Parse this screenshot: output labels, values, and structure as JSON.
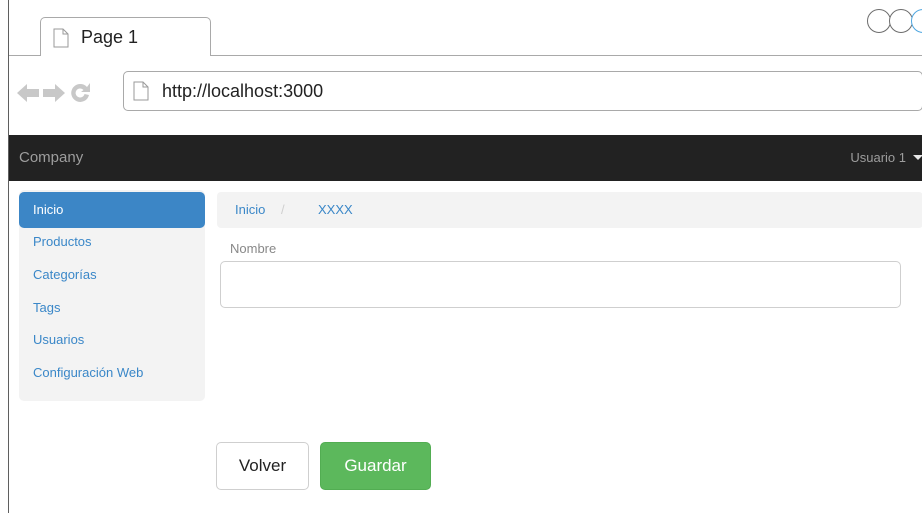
{
  "browser": {
    "tab_title": "Page 1",
    "url": "http://localhost:3000"
  },
  "navbar": {
    "brand": "Company",
    "user": "Usuario 1"
  },
  "sidebar": {
    "items": [
      {
        "label": "Inicio",
        "active": true
      },
      {
        "label": "Productos",
        "active": false
      },
      {
        "label": "Categorías",
        "active": false
      },
      {
        "label": "Tags",
        "active": false
      },
      {
        "label": "Usuarios",
        "active": false
      },
      {
        "label": "Configuración Web",
        "active": false
      }
    ]
  },
  "breadcrumb": {
    "home": "Inicio",
    "separator": "/",
    "current": "XXXX"
  },
  "form": {
    "name_label": "Nombre",
    "name_value": ""
  },
  "buttons": {
    "back": "Volver",
    "save": "Guardar"
  },
  "colors": {
    "navbar_bg": "#222222",
    "accent_blue": "#3c86c6",
    "save_green": "#5cb85c"
  }
}
